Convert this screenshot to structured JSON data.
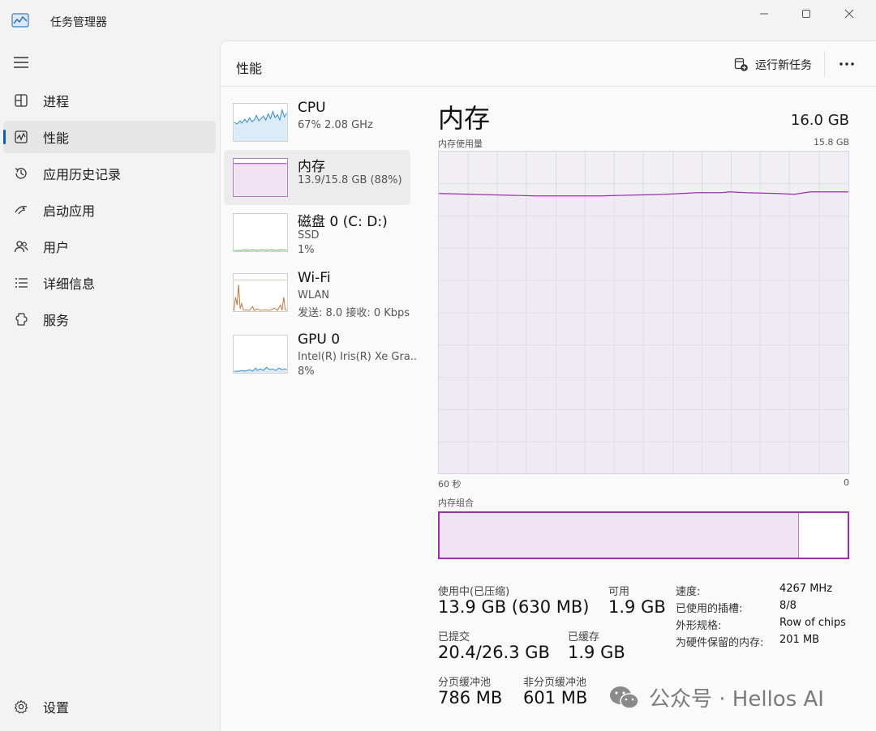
{
  "window": {
    "title": "任务管理器",
    "icon": "chart-window-icon"
  },
  "sidebar": {
    "items": [
      {
        "label": "进程",
        "icon": "processes-icon"
      },
      {
        "label": "性能",
        "icon": "performance-icon",
        "active": true
      },
      {
        "label": "应用历史记录",
        "icon": "app-history-icon"
      },
      {
        "label": "启动应用",
        "icon": "startup-icon"
      },
      {
        "label": "用户",
        "icon": "users-icon"
      },
      {
        "label": "详细信息",
        "icon": "details-icon"
      },
      {
        "label": "服务",
        "icon": "services-icon"
      }
    ],
    "settings_label": "设置"
  },
  "header": {
    "title": "性能",
    "run_task_label": "运行新任务"
  },
  "resources": [
    {
      "name": "CPU",
      "line1": "67% 2.08 GHz",
      "line2": ""
    },
    {
      "name": "内存",
      "line1": "13.9/15.8 GB (88%)",
      "line2": "",
      "active": true
    },
    {
      "name": "磁盘 0 (C: D:)",
      "line1": "SSD",
      "line2": "1%"
    },
    {
      "name": "Wi-Fi",
      "line1": "WLAN",
      "line2": "发送: 8.0 接收: 0 Kbps"
    },
    {
      "name": "GPU 0",
      "line1": "Intel(R) Iris(R) Xe Gra..",
      "line2": "8%"
    }
  ],
  "memory": {
    "title": "内存",
    "total": "16.0 GB",
    "usage_label": "内存使用量",
    "usage_max": "15.8 GB",
    "time_left": "60 秒",
    "time_right": "0",
    "composition_label": "内存组合",
    "composition_used_fraction": 0.88,
    "stats": {
      "in_use_label": "使用中(已压缩)",
      "in_use_value": "13.9 GB (630 MB)",
      "available_label": "可用",
      "available_value": "1.9 GB",
      "committed_label": "已提交",
      "committed_value": "20.4/26.3 GB",
      "cached_label": "已缓存",
      "cached_value": "1.9 GB",
      "paged_label": "分页缓冲池",
      "paged_value": "786 MB",
      "nonpaged_label": "非分页缓冲池",
      "nonpaged_value": "601 MB"
    },
    "details": [
      {
        "key": "速度:",
        "value": "4267 MHz"
      },
      {
        "key": "已使用的插槽:",
        "value": "8/8"
      },
      {
        "key": "外形规格:",
        "value": "Row of chips"
      },
      {
        "key": "为硬件保留的内存:",
        "value": "201 MB"
      }
    ]
  },
  "watermark": {
    "text": "公众号 · Hellos AI"
  },
  "colors": {
    "memory_accent": "#9b2fae",
    "cpu_line": "#2a88d8",
    "disk_line": "#4da84d",
    "wifi_line": "#c8703b",
    "gpu_line": "#2a88d8",
    "nav_indicator": "#0a5fb8"
  }
}
